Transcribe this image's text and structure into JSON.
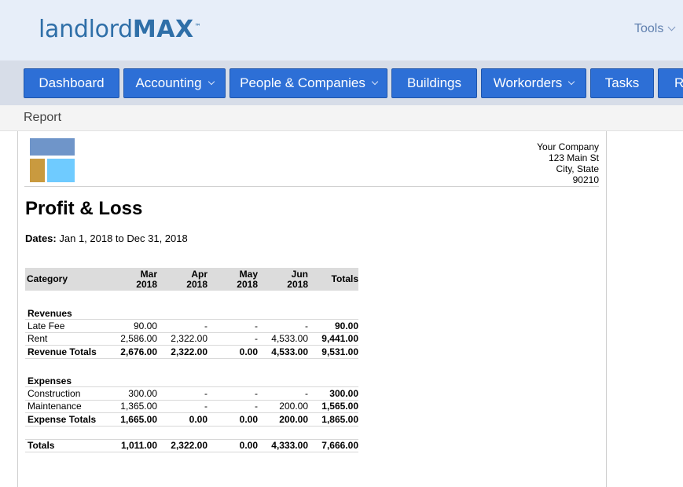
{
  "app": {
    "logo_light": "landlord",
    "logo_bold": "MAX",
    "logo_tm": "™",
    "tools_label": "Tools"
  },
  "nav": {
    "dashboard": "Dashboard",
    "accounting": "Accounting",
    "people": "People & Companies",
    "buildings": "Buildings",
    "workorders": "Workorders",
    "tasks": "Tasks",
    "reports_partial": "Re"
  },
  "subbar": {
    "title": "Report"
  },
  "company": {
    "name": "Your Company",
    "street": "123 Main St",
    "city": "City, State",
    "zip": "90210"
  },
  "report": {
    "title": "Profit & Loss",
    "dates_label": "Dates:",
    "dates_value": "Jan 1, 2018 to Dec 31, 2018",
    "headers": {
      "category": "Category",
      "mar_month": "Mar",
      "mar_year": "2018",
      "apr_month": "Apr",
      "apr_year": "2018",
      "may_month": "May",
      "may_year": "2018",
      "jun_month": "Jun",
      "jun_year": "2018",
      "totals": "Totals"
    },
    "revenues": {
      "label": "Revenues",
      "rows": [
        {
          "name": "Late Fee",
          "mar": "90.00",
          "apr": "-",
          "may": "-",
          "jun": "-",
          "total": "90.00"
        },
        {
          "name": "Rent",
          "mar": "2,586.00",
          "apr": "2,322.00",
          "may": "-",
          "jun": "4,533.00",
          "total": "9,441.00"
        }
      ],
      "totals": {
        "name": "Revenue Totals",
        "mar": "2,676.00",
        "apr": "2,322.00",
        "may": "0.00",
        "jun": "4,533.00",
        "total": "9,531.00"
      }
    },
    "expenses": {
      "label": "Expenses",
      "rows": [
        {
          "name": "Construction",
          "mar": "300.00",
          "apr": "-",
          "may": "-",
          "jun": "-",
          "total": "300.00"
        },
        {
          "name": "Maintenance",
          "mar": "1,365.00",
          "apr": "-",
          "may": "-",
          "jun": "200.00",
          "total": "1,565.00"
        }
      ],
      "totals": {
        "name": "Expense Totals",
        "mar": "1,665.00",
        "apr": "0.00",
        "may": "0.00",
        "jun": "200.00",
        "total": "1,865.00"
      }
    },
    "grand_totals": {
      "name": "Totals",
      "mar": "1,011.00",
      "apr": "2,322.00",
      "may": "0.00",
      "jun": "4,333.00",
      "total": "7,666.00"
    }
  }
}
